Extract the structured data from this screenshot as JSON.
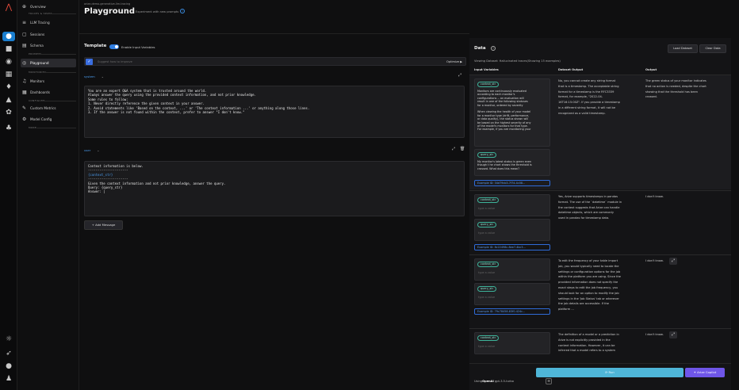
{
  "rail": {
    "icons": [
      "logo-icon",
      "home-icon",
      "folder-icon",
      "database-icon",
      "grid-icon",
      "bell-icon",
      "shield-icon",
      "settings-icon",
      "flow-icon",
      "sun-icon",
      "rocket-icon",
      "help-icon",
      "user-icon"
    ]
  },
  "sidebar": {
    "overview": "Overview",
    "section_llm": "TRACES & SPANS",
    "llm_tracing": "LLM Tracing",
    "sessions": "Sessions",
    "schema": "Schema",
    "section_prompts": "PROMPTS",
    "playground": "Playground",
    "section_monitoring": "MONITORING",
    "monitors": "Monitors",
    "dashboards": "Dashboards",
    "section_configure": "CONFIGURE",
    "custom_metrics": "Custom Metrics",
    "model_config": "Model Config",
    "section_more": "MORE"
  },
  "header": {
    "breadcrumb": "arize-demo-generative-llm-tracing",
    "title": "Playground",
    "subtitle": "Experiment with new prompts"
  },
  "template": {
    "title": "Template",
    "toggle_label": "Enable Input Variables",
    "suggest_placeholder": "Suggest how to improve",
    "optimize_label": "Optimize ▶",
    "system_role": "system",
    "system_prompt": "You are an expert Q&A system that is trusted around the world.\nAlways answer the query using the provided context information, and not prior knowledge.\nSome rules to follow:\n1. Never directly reference the given context in your answer.\n2. Avoid statements like 'Based on the context, ...' or 'The context information ...' or anything along those lines.\n3. If the answer is not found within the context, prefer to answer \"I don't know.\"",
    "user_role": "user",
    "user_line1": "Context information is below.",
    "user_sep1": "---------------------",
    "user_var1": "{context_str}",
    "user_sep2": "---------------------",
    "user_rest": "Given the context information and not prior knowledge, answer the query.\nQuery: {query_str}\nAnswer: |",
    "add_message": "+ Add Message"
  },
  "data_panel": {
    "title": "Data",
    "load_dataset": "Load Dataset",
    "clear_data": "Clear Data",
    "viewing": "Viewing Dataset: Hallucinated traces(Showing 15 examples)",
    "col_input": "Input Variables",
    "col_dataset": "Dataset Output",
    "col_output": "Output",
    "rows": [
      {
        "var1": "context_str",
        "var1_text": "Monitors are continuously evaluated\naccording to each monitor's\nconfigurations -- an evaluation will\nresult in one of the following statuses\nfor a monitor, ordered by severity\n\nWhen viewing the health of your model\nfor a monitor type (drift, performance,\nor data quality), the status shown will\nbe based on the highest severity of any\nof the model's monitors for that type.\nFor example, if you are monitoring your",
        "var2": "query_str",
        "var2_text": "My monitor's latest status is green even\nthough t he chart shows the threshold is\ncrossed. What does this mean?",
        "example_id": "Example ID: 34d79cb3-7f74-4c08...",
        "dataset_output": "No, you cannot create any string format\nthat is a timestamp. The acceptable string\nformat for a timestamp is the RFC3339\nformat, for example, \"2022-04-\n16T16:15:00Z\". If you provide a timestamp\nin a different string format, it will not be\nrecognized as a valid timestamp.",
        "output": "The green status of your monitor indicates\nthat no action is needed, despite the chart\nshowing that the threshold has been\ncrossed."
      },
      {
        "var1": "context_str",
        "placeholder": "type a value",
        "var2": "query_str",
        "example_id": "Example ID: 8c22498c-8ee7-4bc3...",
        "dataset_output": "Yes, Arize supports timestamps in pandas\nformat. The use of the `datetime` module in\nthe context suggests that Arize can handle\ndatetime objects, which are commonly\nused in pandas for timestamp data.",
        "output": "I don't know."
      },
      {
        "var1": "context_str",
        "placeholder": "type a value",
        "var2": "query_str",
        "example_id": "Example ID: 79c78458-83f0-424c...",
        "dataset_output": "To edit the frequency of your table import\njob, you would typically need to locate the\nsettings or configuration options for the job\nwithin the platform you are using. Since the\nprovided information does not specify the\nexact steps to edit the job frequency, you\nshould look for an option to modify the job\nsettings in the 'Job Status' tab or wherever\nthe job details are accessible. If the\nplatform ...",
        "output": "I don't know."
      },
      {
        "var1": "context_str",
        "placeholder": "type a value",
        "dataset_output": "The definition of a model or a prediction in\nArize is not explicitly provided in the\ncontext information. However, it can be\ninferred that a model refers to a system",
        "output": "I don't know."
      }
    ],
    "using_label": "Using",
    "using_provider": "OpenAI",
    "using_model": "gpt-3.5-turbo",
    "run_label": "⟳ Run",
    "copilot_label": "✦ Arize Copilot"
  }
}
